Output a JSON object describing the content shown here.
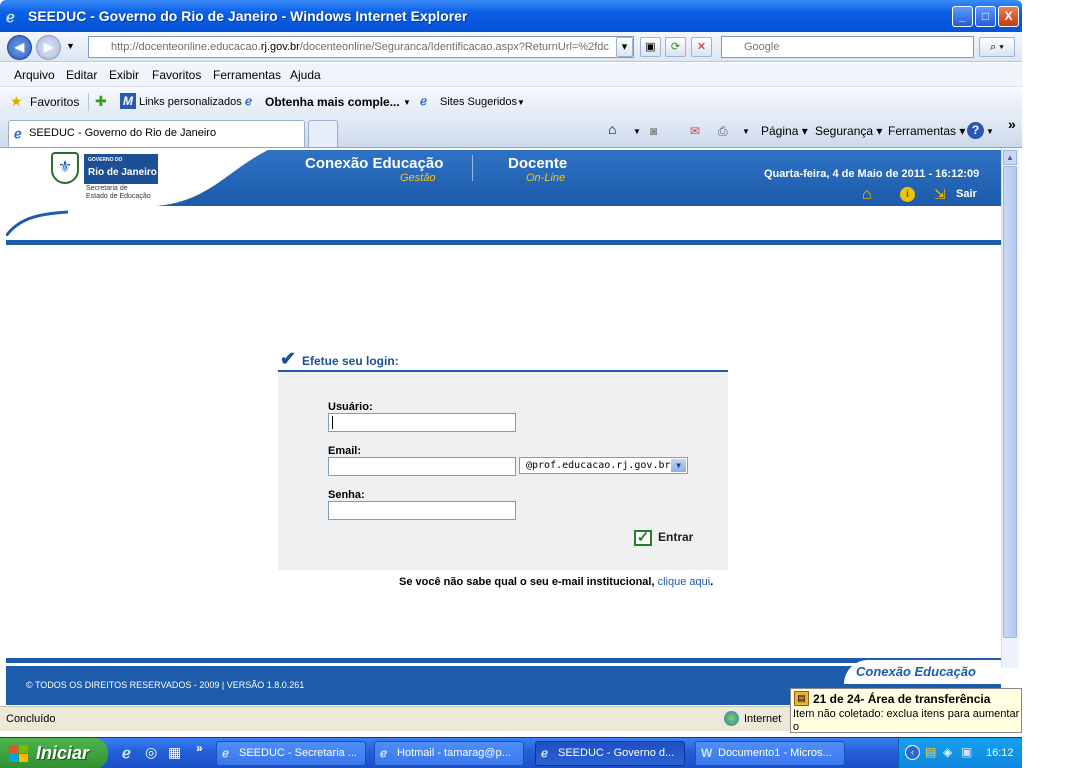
{
  "window": {
    "title": "SEEDUC - Governo do Rio de Janeiro - Windows Internet Explorer",
    "min_label": "_",
    "max_label": "□",
    "close_label": "X"
  },
  "navbar": {
    "url_prefix": "http://docenteonline.educacao.",
    "url_domain": "rj.gov.br",
    "url_suffix": "/docenteonline/Seguranca/Identificacao.aspx?ReturnUrl=%2fdc",
    "search_placeholder": "Google"
  },
  "menu": [
    "Arquivo",
    "Editar",
    "Exibir",
    "Favoritos",
    "Ferramentas",
    "Ajuda"
  ],
  "favorites": {
    "favoritos": "Favoritos",
    "links": "Links personalizados",
    "obtenha": "Obtenha mais comple...",
    "sites": "Sites Sugeridos"
  },
  "tabs": {
    "active": "SEEDUC - Governo do Rio de Janeiro",
    "overflow": "»"
  },
  "commands": {
    "pagina": "Página",
    "seguranca": "Segurança",
    "ferramentas": "Ferramentas"
  },
  "site": {
    "logo_small": "GOVERNO DO",
    "logo_big": "Rio de Janeiro",
    "logo_sub1": "Secretaria de",
    "logo_sub2": "Estado de Educação",
    "brand1_title": "Conexão Educação",
    "brand1_sub": "Gestão",
    "brand2_title": "Docente",
    "brand2_sub": "On-Line",
    "datetime": "Quarta-feira, 4 de Maio de 2011 - 16:12:09",
    "logout": "Sair"
  },
  "login": {
    "title": "Efetue seu login:",
    "user_label": "Usuário:",
    "email_label": "Email:",
    "password_label": "Senha:",
    "email_domain": "@prof.educacao.rj.gov.br",
    "submit": "Entrar",
    "help_text": "Se você não sabe qual o seu e-mail institucional,",
    "help_link": "clique aqui",
    "help_end": "."
  },
  "footer": {
    "copyright": "© TODOS OS DIREITOS RESERVADOS - 2009 | VERSÃO 1.8.0.261",
    "brand": "Conexão Educação"
  },
  "status": {
    "text": "Concluído",
    "zone": "Internet"
  },
  "balloon": {
    "title": "21 de 24- Área de transferência",
    "text": "Item não coletado: exclua itens para aumentar o"
  },
  "taskbar": {
    "start": "Iniciar",
    "tasks": [
      "SEEDUC - Secretaria ...",
      "Hotmail - tamarag@p...",
      "SEEDUC - Governo d...",
      "Documento1 - Micros..."
    ],
    "clock": "16:12"
  }
}
